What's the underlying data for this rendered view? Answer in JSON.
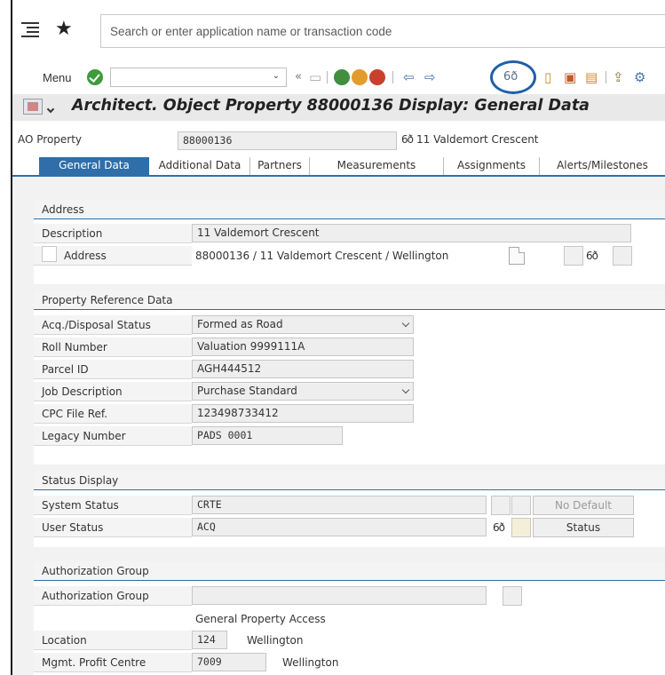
{
  "search": {
    "placeholder": "Search or enter application name or transaction code"
  },
  "toolbar": {
    "menu_label": "Menu"
  },
  "title": "Architect. Object Property 88000136 Display: General Data",
  "header": {
    "ao_label": "AO Property",
    "ao_value": "88000136",
    "ao_desc": "11 Valdemort Crescent",
    "glasses": "6ð"
  },
  "tabs": [
    "General Data",
    "Additional Data",
    "Partners",
    "Measurements",
    "Assignments",
    "Alerts/Milestones"
  ],
  "address": {
    "title": "Address",
    "description_label": "Description",
    "description_value": "11 Valdemort Crescent",
    "address_label": "Address",
    "address_value": "88000136 / 11 Valdemort Crescent / Wellington"
  },
  "prd": {
    "title": "Property Reference Data",
    "acq_label": "Acq./Disposal Status",
    "acq_value": "Formed as Road",
    "roll_label": "Roll Number",
    "roll_value": "Valuation 9999111A",
    "parcel_label": "Parcel ID",
    "parcel_value": "AGH444512",
    "job_label": "Job Description",
    "job_value": "Purchase Standard",
    "cpc_label": "CPC File Ref.",
    "cpc_value": "123498733412",
    "legacy_label": "Legacy Number",
    "legacy_value": "PADS 0001"
  },
  "status": {
    "title": "Status Display",
    "system_label": "System Status",
    "system_value": "CRTE",
    "user_label": "User Status",
    "user_value": "ACQ",
    "no_default": "No Default",
    "status_btn": "Status"
  },
  "auth": {
    "title": "Authorization Group",
    "group_label": "Authorization Group",
    "general_access": "General Property Access",
    "location_label": "Location",
    "location_code": "124",
    "location_name": "Wellington",
    "profit_label": "Mgmt. Profit Centre",
    "profit_code": "7009",
    "profit_name": "Wellington"
  }
}
